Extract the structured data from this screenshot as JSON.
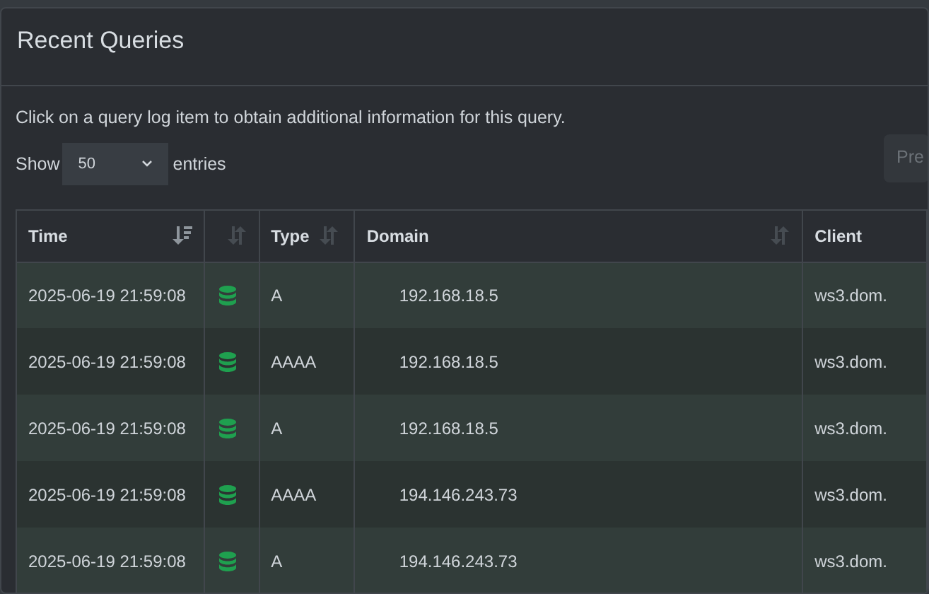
{
  "card": {
    "title": "Recent Queries"
  },
  "intro": "Click on a query log item to obtain additional information for this query.",
  "length": {
    "before": "Show",
    "value": "50",
    "after": "entries"
  },
  "previous_button": {
    "label": "Pre",
    "disabled": true
  },
  "table": {
    "columns": [
      {
        "label": "Time",
        "sorted": true
      },
      {
        "sorted": false
      },
      {
        "label": "Type",
        "sorted": false
      },
      {
        "label": "Domain",
        "sorted": false
      },
      {
        "label": "Client"
      }
    ],
    "rows": [
      {
        "time": "2025-06-19 21:59:08",
        "type": "A",
        "domain": "192.168.18.5",
        "client": "ws3.dom."
      },
      {
        "time": "2025-06-19 21:59:08",
        "type": "AAAA",
        "domain": "192.168.18.5",
        "client": "ws3.dom."
      },
      {
        "time": "2025-06-19 21:59:08",
        "type": "A",
        "domain": "192.168.18.5",
        "client": "ws3.dom."
      },
      {
        "time": "2025-06-19 21:59:08",
        "type": "AAAA",
        "domain": "194.146.243.73",
        "client": "ws3.dom."
      },
      {
        "time": "2025-06-19 21:59:08",
        "type": "A",
        "domain": "194.146.243.73",
        "client": "ws3.dom."
      }
    ]
  }
}
